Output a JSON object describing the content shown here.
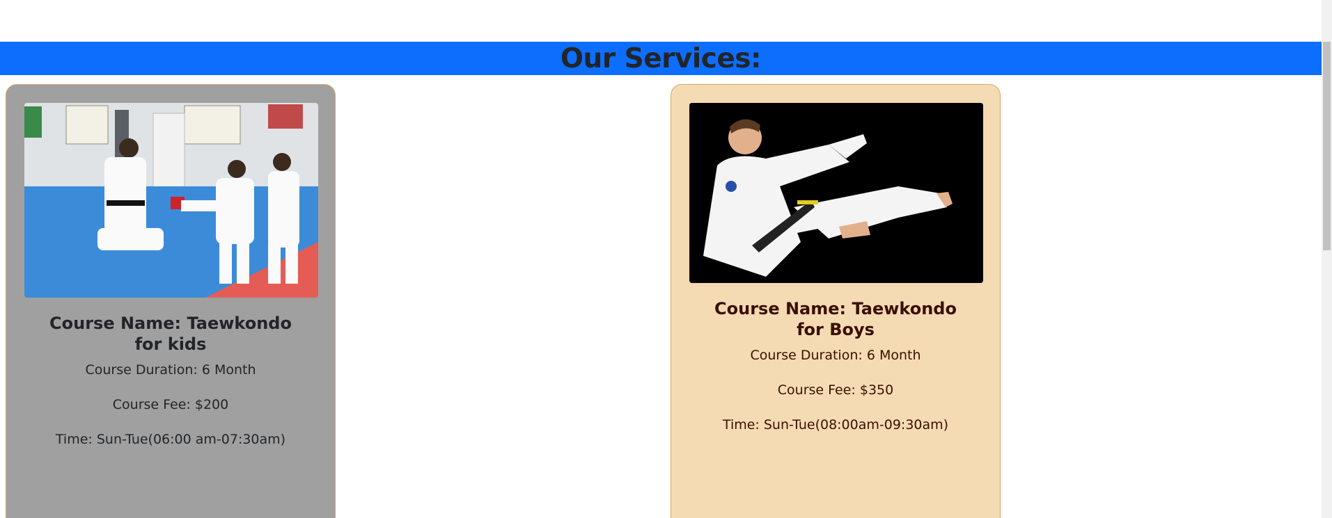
{
  "services": {
    "heading": "Our Services:"
  },
  "courses": [
    {
      "title": "Course Name: Taewkondo for kids",
      "duration": "Course Duration: 6 Month",
      "fee": "Course Fee: $200",
      "time": "Time: Sun-Tue(06:00 am-07:30am)",
      "background": "#a0a0a0"
    },
    {
      "title": "Course Name: Taewkondo for Boys",
      "duration": "Course Duration: 6 Month",
      "fee": "Course Fee: $350",
      "time": "Time: Sun-Tue(08:00am-09:30am)",
      "background": "#f5dbb3"
    }
  ],
  "colors": {
    "banner": "#0d6efd",
    "card_border": "#d4a56a"
  }
}
